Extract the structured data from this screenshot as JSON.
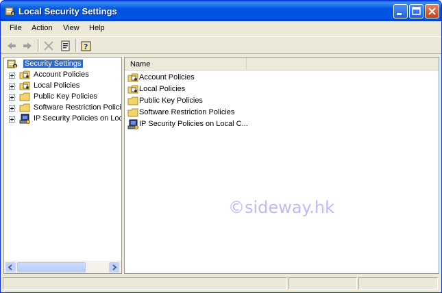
{
  "window": {
    "title": "Local Security Settings"
  },
  "menu": {
    "items": [
      "File",
      "Action",
      "View",
      "Help"
    ]
  },
  "tree": {
    "root": {
      "label": "Security Settings",
      "icon": "security-settings-icon"
    },
    "items": [
      {
        "label": "Account Policies",
        "icon": "policy-folder-icon"
      },
      {
        "label": "Local Policies",
        "icon": "policy-folder-icon"
      },
      {
        "label": "Public Key Policies",
        "icon": "folder-icon"
      },
      {
        "label": "Software Restriction Policie",
        "icon": "folder-icon"
      },
      {
        "label": "IP Security Policies on Loca",
        "icon": "ip-security-icon"
      }
    ]
  },
  "list": {
    "column_header": "Name",
    "rows": [
      {
        "label": "Account Policies",
        "icon": "policy-folder-icon"
      },
      {
        "label": "Local Policies",
        "icon": "policy-folder-icon"
      },
      {
        "label": "Public Key Policies",
        "icon": "folder-icon"
      },
      {
        "label": "Software Restriction Policies",
        "icon": "folder-icon"
      },
      {
        "label": "IP Security Policies on Local C...",
        "icon": "ip-security-icon"
      }
    ]
  },
  "watermark": "©sideway.hk",
  "colors": {
    "titlebar": "#0054e3",
    "selection": "#316ac5",
    "chrome": "#ece9d8",
    "watermark": "#c7b6f5"
  }
}
